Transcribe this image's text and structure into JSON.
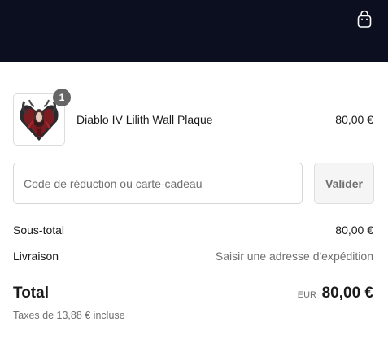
{
  "header": {
    "background_color": "#0c0f1f",
    "cart_icon": "shopping-bag-icon"
  },
  "line_item": {
    "name": "Diablo IV Lilith Wall Plaque",
    "price": "80,00 €",
    "quantity": "1",
    "thumbnail_icon": "lilith-plaque-image"
  },
  "discount": {
    "placeholder": "Code de réduction ou carte-cadeau",
    "value": "",
    "apply_label": "Valider"
  },
  "summary": {
    "subtotal_label": "Sous-total",
    "subtotal_value": "80,00 €",
    "shipping_label": "Livraison",
    "shipping_value": "Saisir une adresse d'expédition",
    "total_label": "Total",
    "total_currency": "EUR",
    "total_value": "80,00 €",
    "taxes_note": "Taxes de 13,88 € incluse"
  }
}
